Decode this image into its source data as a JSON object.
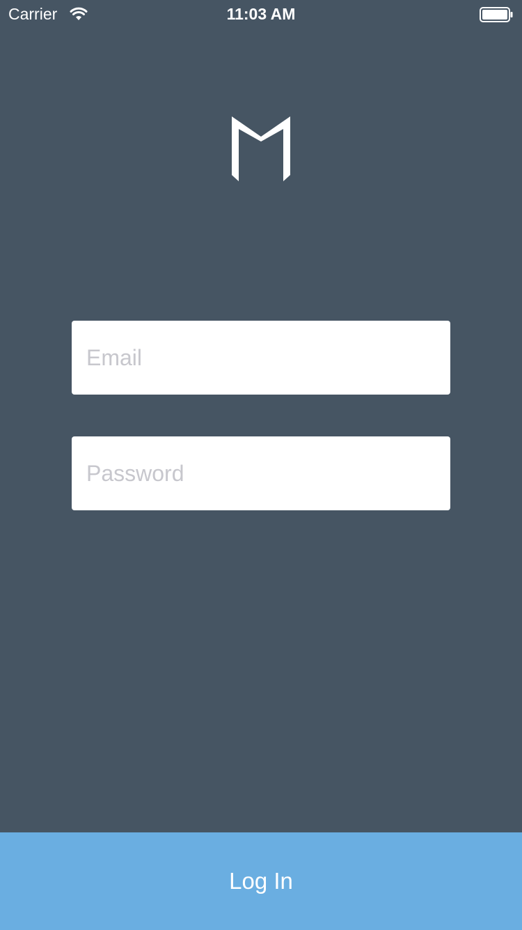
{
  "status_bar": {
    "carrier": "Carrier",
    "time": "11:03 AM",
    "wifi_icon": "wifi-icon",
    "battery_icon": "battery-full-icon",
    "battery_level": 1.0
  },
  "logo": {
    "icon": "m-logo-icon",
    "color": "#ffffff"
  },
  "form": {
    "email": {
      "placeholder": "Email",
      "value": ""
    },
    "password": {
      "placeholder": "Password",
      "value": ""
    }
  },
  "login_button": {
    "label": "Log In"
  },
  "colors": {
    "background": "#465563",
    "button": "#6aaee1",
    "field": "#ffffff",
    "placeholder": "#c7c7cd"
  }
}
